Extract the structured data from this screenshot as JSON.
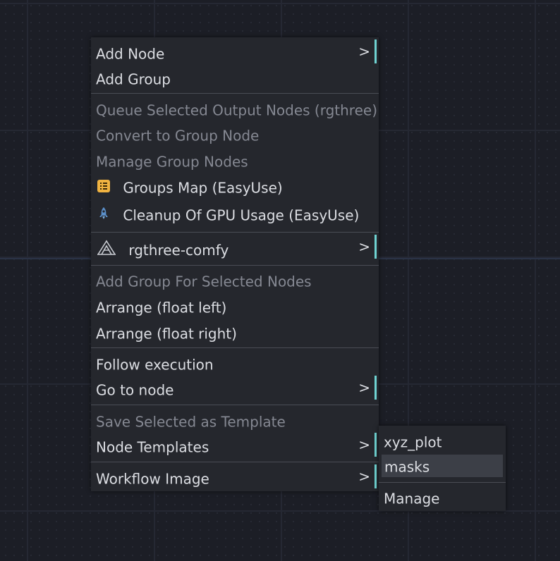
{
  "context_menu": {
    "items": [
      {
        "label": "Add Node",
        "has_submenu": true
      },
      {
        "label": "Add Group"
      },
      {
        "label": "Queue Selected Output Nodes (rgthree)",
        "disabled": true
      },
      {
        "label": "Convert to Group Node",
        "disabled": true
      },
      {
        "label": "Manage Group Nodes",
        "disabled": true
      },
      {
        "label": "Groups Map (EasyUse)",
        "icon": "list-icon"
      },
      {
        "label": "Cleanup Of GPU Usage (EasyUse)",
        "icon": "rocket-icon"
      },
      {
        "label": "rgthree-comfy",
        "icon": "rgthree-logo-icon",
        "has_submenu": true
      },
      {
        "label": "Add Group For Selected Nodes",
        "disabled": true
      },
      {
        "label": "Arrange (float left)"
      },
      {
        "label": "Arrange (float right)"
      },
      {
        "label": "Follow execution"
      },
      {
        "label": "Go to node",
        "has_submenu": true
      },
      {
        "label": "Save Selected as Template",
        "disabled": true
      },
      {
        "label": "Node Templates",
        "has_submenu": true
      },
      {
        "label": "Workflow Image",
        "has_submenu": true
      }
    ],
    "submenu_arrow": ">"
  },
  "templates_submenu": {
    "items": [
      {
        "label": "xyz_plot"
      },
      {
        "label": "masks",
        "highlighted": true
      },
      {
        "label": "Manage"
      }
    ]
  },
  "colors": {
    "background": "#1c1e26",
    "menu_bg": "#25272d",
    "text": "#dcdee3",
    "disabled_text": "#858892",
    "accent_bar": "#6fd3d2",
    "groups_map_icon": "#f0b341",
    "rocket_icon": "#5b8fc9"
  }
}
